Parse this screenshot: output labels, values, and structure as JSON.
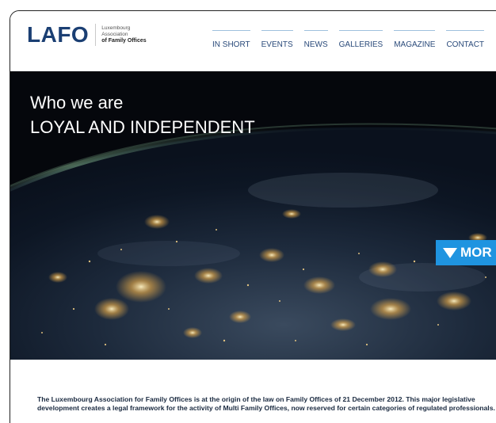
{
  "logo": {
    "mark": "LAFO",
    "line1": "Luxembourg",
    "line2": "Association",
    "line3": "of Family Offices"
  },
  "nav": {
    "items": [
      "IN SHORT",
      "EVENTS",
      "NEWS",
      "GALLERIES",
      "MAGAZINE",
      "CONTACT"
    ]
  },
  "hero": {
    "title": "Who we are",
    "subtitle": "LOYAL AND INDEPENDENT",
    "more_label": "MOR"
  },
  "intro": {
    "text": "The Luxembourg Association for Family Offices is at the origin of the law on Family Offices of 21 December 2012. This major legislative development creates a legal framework for the activity of Multi Family Offices, now reserved for certain categories of regulated professionals."
  },
  "colors": {
    "brand_blue": "#1b3f73",
    "nav_text": "#2a4a7a",
    "more_button": "#1f94e0"
  }
}
